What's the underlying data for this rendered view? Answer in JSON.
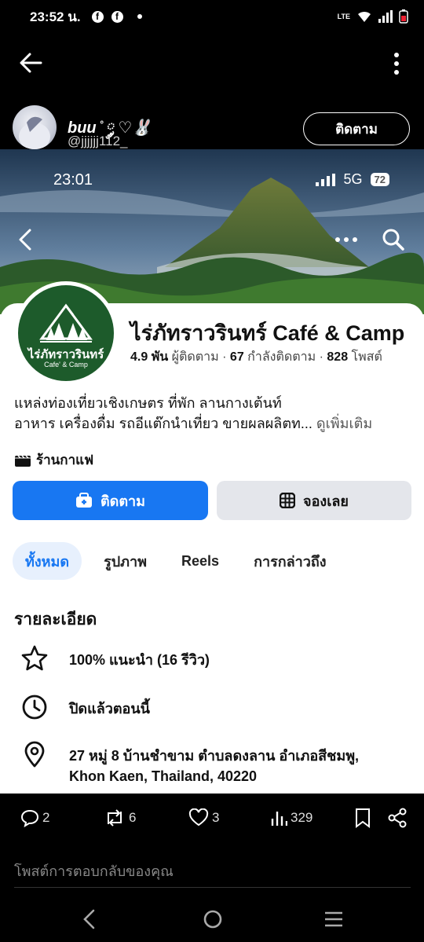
{
  "status_bar": {
    "time": "23:52 น.",
    "fb1": "f",
    "fb2": "f",
    "network": "LTE"
  },
  "post": {
    "author_name": "buu ̊ ༘ ♡🐰",
    "author_handle": "@jjjjjj112_",
    "follow_label": "ติดตาม"
  },
  "screenshot": {
    "status_time": "23:01",
    "status_network": "5G",
    "status_battery": "72",
    "page_name": "ไร่ภัทราวรินทร์  Café & Camp",
    "logo_name": "ไร่ภัทราวรินทร์",
    "logo_sub": "Cafe' & Camp",
    "stats": {
      "followers_value": "4.9 พัน",
      "followers_label": "ผู้ติดตาม",
      "following_value": "67",
      "following_label": "กำลังติดตาม",
      "posts_value": "828",
      "posts_label": "โพสต์"
    },
    "bio_line1": "แหล่งท่องเที่ยวเชิงเกษตร ที่พัก ลานกางเต้นท์",
    "bio_line2": "อาหาร เครื่องดื่ม รถอีแต๊กนำเที่ยว ขายผลผลิตท...",
    "see_more": "ดูเพิ่มเติม",
    "category": "ร้านกาแฟ",
    "follow_button": "ติดตาม",
    "book_button": "จองเลย",
    "tabs": [
      {
        "label": "ทั้งหมด",
        "active": true
      },
      {
        "label": "รูปภาพ",
        "active": false
      },
      {
        "label": "Reels",
        "active": false
      },
      {
        "label": "การกล่าวถึง",
        "active": false
      }
    ],
    "details_title": "รายละเอียด",
    "details": {
      "rating": "100% แนะนำ (16 รีวิว)",
      "hours": "ปิดแล้วตอนนี้",
      "address": "27 หมู่ 8 บ้านชำขาม ตำบลดงลาน อำเภอสีชมพู, Khon Kaen, Thailand, 40220"
    }
  },
  "engagement": {
    "replies": "2",
    "reposts": "6",
    "likes": "3",
    "views": "329"
  },
  "reply_placeholder": "โพสต์การตอบกลับของคุณ",
  "colors": {
    "fb_blue": "#1877f2",
    "logo_green": "#1d5b2b",
    "bg": "#000000"
  }
}
